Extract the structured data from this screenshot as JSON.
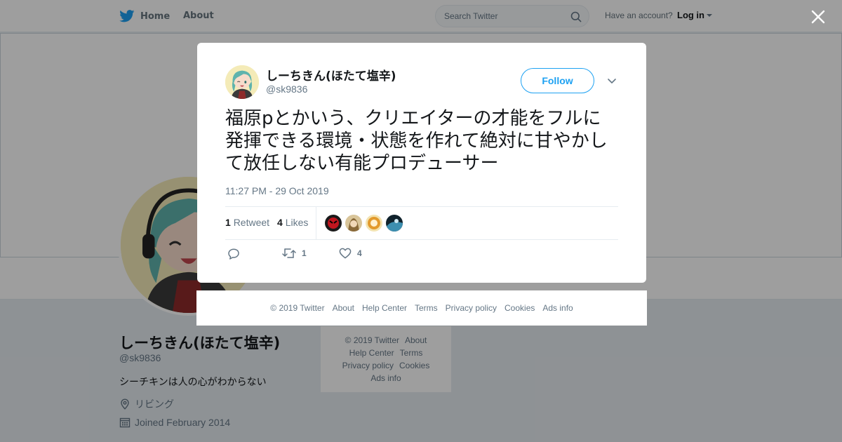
{
  "nav": {
    "home": "Home",
    "about": "About",
    "search_placeholder": "Search Twitter",
    "have_account": "Have an account?",
    "login": "Log in"
  },
  "profile": {
    "name": "しーちきん(ほたて塩辛)",
    "handle": "@sk9836",
    "bio": "シーチキンは人の心がわからない",
    "location": "リビング",
    "joined": "Joined February 2014"
  },
  "bg_footer": {
    "copyright": "© 2019 Twitter",
    "about": "About",
    "help": "Help Center",
    "terms": "Terms",
    "privacy": "Privacy policy",
    "cookies": "Cookies",
    "ads": "Ads info"
  },
  "tweet": {
    "author_name": "しーちきん(ほたて塩辛)",
    "author_handle": "@sk9836",
    "follow_label": "Follow",
    "text": "福原pとかいう、クリエイターの才能をフルに発揮できる環境・状態を作れて絶対に甘やかして放任しない有能プロデューサー",
    "timestamp": "11:27 PM - 29 Oct 2019",
    "retweet_count": "1",
    "retweet_label": "Retweet",
    "like_count": "4",
    "like_label": "Likes",
    "action_retweet_count": "1",
    "action_like_count": "4"
  },
  "modal_footer": {
    "copyright": "© 2019 Twitter",
    "about": "About",
    "help": "Help Center",
    "terms": "Terms",
    "privacy": "Privacy policy",
    "cookies": "Cookies",
    "ads": "Ads info"
  },
  "colors": {
    "twitter_blue": "#1da1f2",
    "text_secondary": "#657786",
    "text_primary": "#14171a"
  }
}
